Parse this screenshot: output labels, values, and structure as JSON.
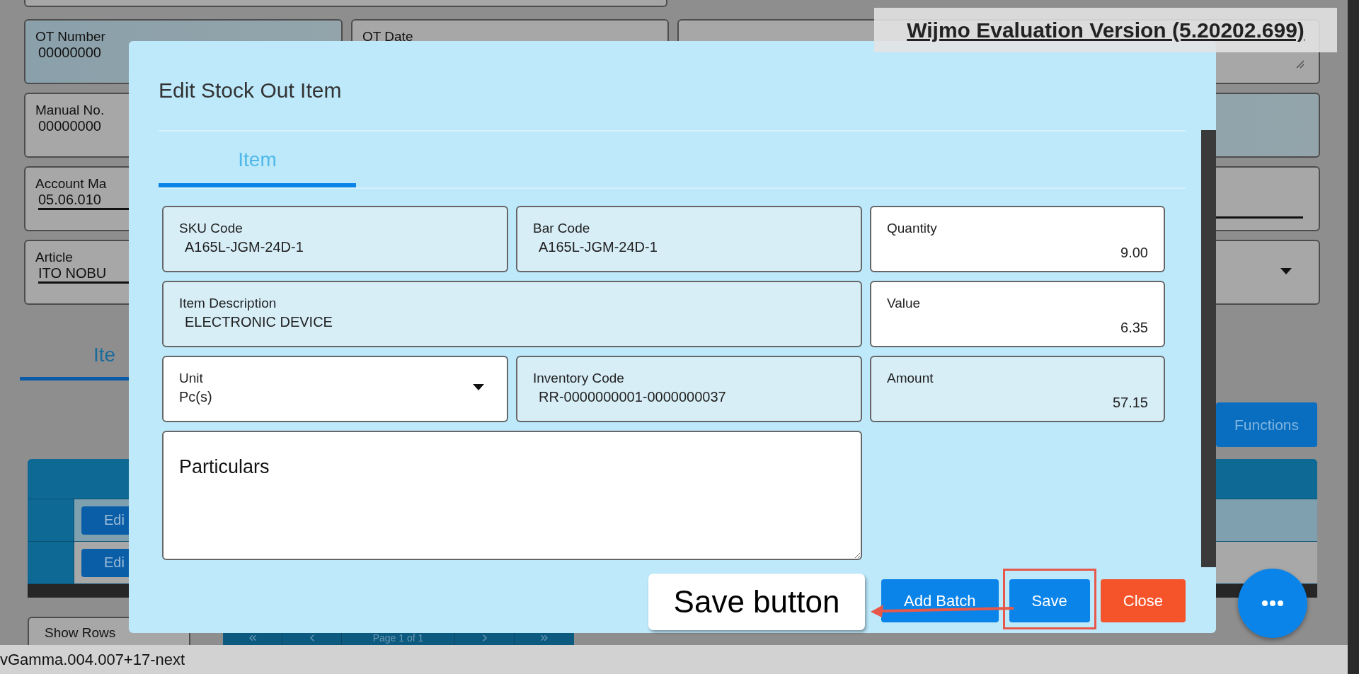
{
  "evaluation_banner": "Wijmo Evaluation Version (5.20202.699)",
  "page": {
    "left_fields": [
      {
        "label": "OT Number",
        "value": "00000000",
        "kind": "readonly"
      },
      {
        "label": "Manual No.",
        "value": "00000000",
        "kind": "plain"
      },
      {
        "label": "Account Ma",
        "value": "05.06.010",
        "kind": "input"
      },
      {
        "label": "Article",
        "value": "ITO NOBU",
        "kind": "input"
      }
    ],
    "middle_fields": [
      {
        "label": "OT Date"
      }
    ],
    "right_fields": [
      {
        "kind": "textarea"
      },
      {
        "kind": "readonly"
      },
      {
        "kind": "input"
      },
      {
        "kind": "select"
      }
    ],
    "tabs": [
      {
        "label": "Ite",
        "selected": true
      }
    ],
    "functions_button": "Functions",
    "grid_rows": [
      {
        "action": "Edi",
        "selected": true
      },
      {
        "action": "Edi",
        "selected": false
      }
    ],
    "show_rows": "Show Rows",
    "pager": "Page 1 of 1"
  },
  "status_bar": "vGamma.004.007+17-next",
  "modal": {
    "title": "Edit Stock Out Item",
    "tabs": [
      {
        "label": "Item",
        "selected": true
      }
    ],
    "fields": [
      {
        "label": "SKU Code",
        "value": "A165L-JGM-24D-1",
        "kind": "readonly"
      },
      {
        "label": "Bar Code",
        "value": "A165L-JGM-24D-1",
        "kind": "readonly"
      },
      {
        "label": "Quantity",
        "value": "9.00",
        "kind": "input",
        "numeric": true
      },
      {
        "label": "Item Description",
        "value": "ELECTRONIC DEVICE",
        "kind": "readonly",
        "wide": true
      },
      {
        "label": "Value",
        "value": "6.35",
        "kind": "input",
        "numeric": true
      },
      {
        "label": "Unit",
        "value": "Pc(s)",
        "kind": "select"
      },
      {
        "label": "Inventory Code",
        "value": "RR-0000000001-0000000037",
        "kind": "readonly"
      },
      {
        "label": "Amount",
        "value": "57.15",
        "kind": "readonly",
        "numeric": true
      },
      {
        "placeholder": "Particulars",
        "kind": "textarea",
        "wide": true
      }
    ],
    "buttons": [
      {
        "label": "Add Batch",
        "kind": "primary",
        "highlighted": false
      },
      {
        "label": "Save",
        "kind": "primary",
        "highlighted": true
      },
      {
        "label": "Close",
        "kind": "danger",
        "highlighted": false
      }
    ]
  },
  "annotation": {
    "text": "Save button"
  }
}
